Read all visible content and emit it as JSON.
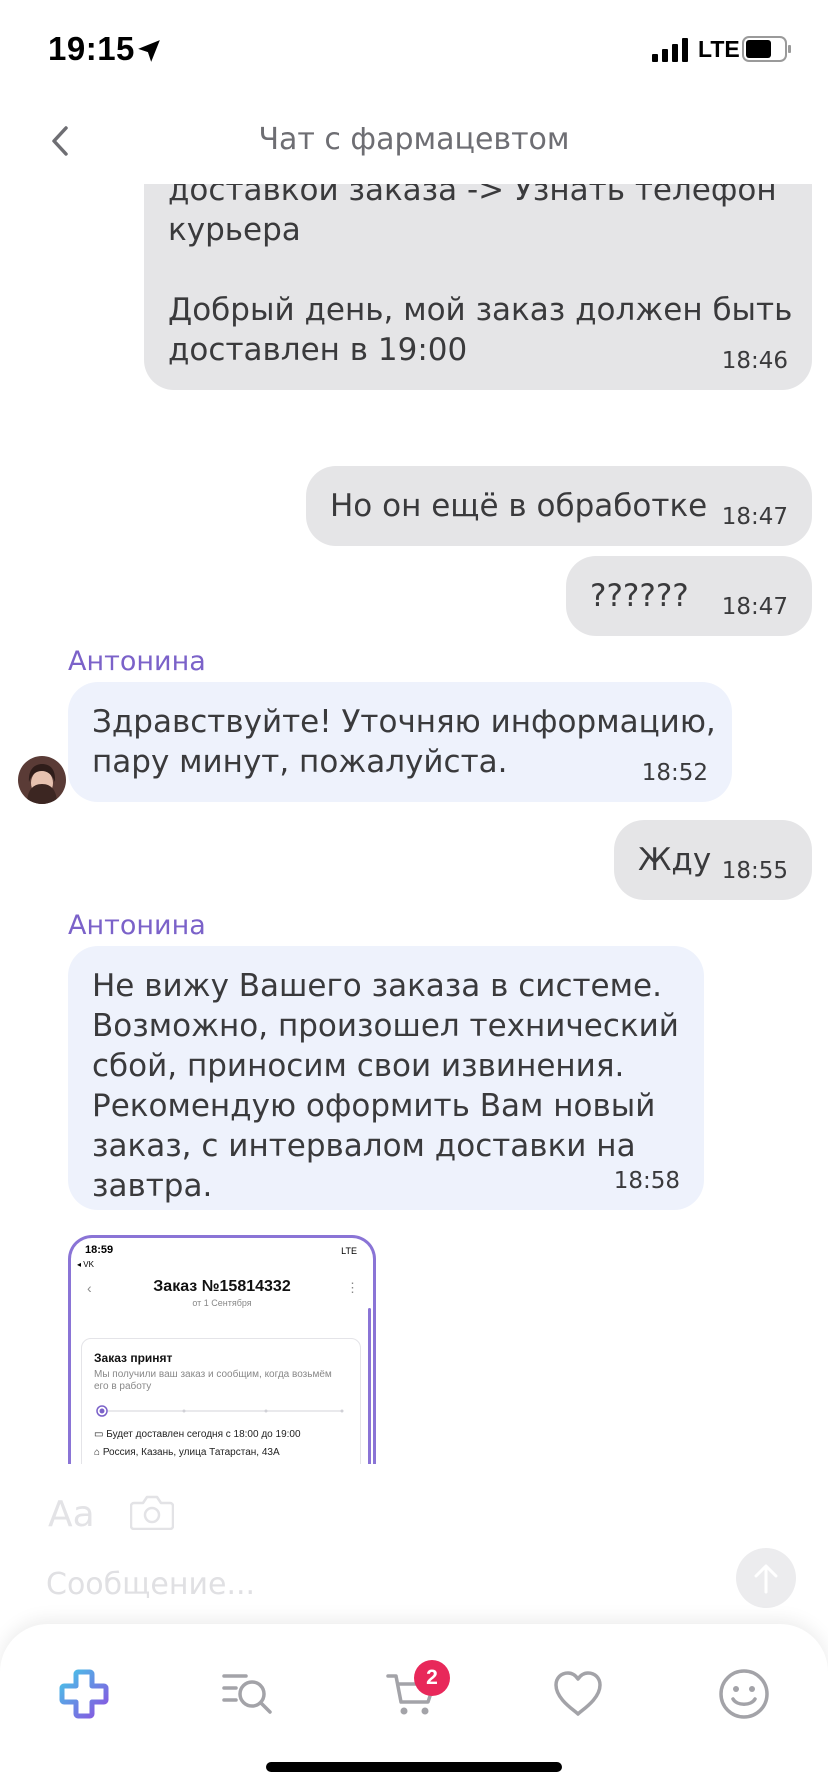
{
  "status_bar": {
    "time": "19:15",
    "network": "LTE"
  },
  "header": {
    "title": "Чат с фармацевтом"
  },
  "messages": [
    {
      "type": "out",
      "text": "доставкой заказа -> Узнать телефон\nкурьера\n\nДобрый день, мой заказ должен быть\nдоставлен в 19:00",
      "time": "18:46"
    },
    {
      "type": "out",
      "text": "Но он ещё в обработке",
      "time": "18:47"
    },
    {
      "type": "out",
      "text": "??????",
      "time": "18:47"
    },
    {
      "type": "in",
      "sender": "Антонина",
      "text": "Здравствуйте! Уточняю информацию,\nпару минут, пожалуйста.",
      "time": "18:52"
    },
    {
      "type": "out",
      "text": "Жду",
      "time": "18:55"
    },
    {
      "type": "in",
      "sender": "Антонина",
      "text": "Не вижу Вашего заказа в системе.\nВозможно, произошел технический\nсбой, приносим свои извинения.\nРекомендую оформить Вам новый\nзаказ, с интервалом доставки на\nзавтра.",
      "time": "18:58"
    }
  ],
  "attachment": {
    "time": "18:59",
    "back_app": "◂ VK",
    "network": "LTE",
    "title": "Заказ №15814332",
    "subtitle": "от 1 Сентября",
    "status_title": "Заказ принят",
    "status_text": "Мы получили ваш заказ и сообщим, когда возьмём его в работу",
    "delivery": "Будет доставлен сегодня с 18:00 до 19:00",
    "address": "Россия, Казань, улица Татарстан, 43А"
  },
  "composer": {
    "aa_label": "Aa",
    "placeholder": "Сообщение..."
  },
  "tabbar": {
    "cart_badge": "2"
  },
  "colors": {
    "accent": "#7b62c9",
    "badge": "#e8285a",
    "incoming_bubble": "#eef2fc",
    "outgoing_bubble": "#e5e5e7"
  }
}
